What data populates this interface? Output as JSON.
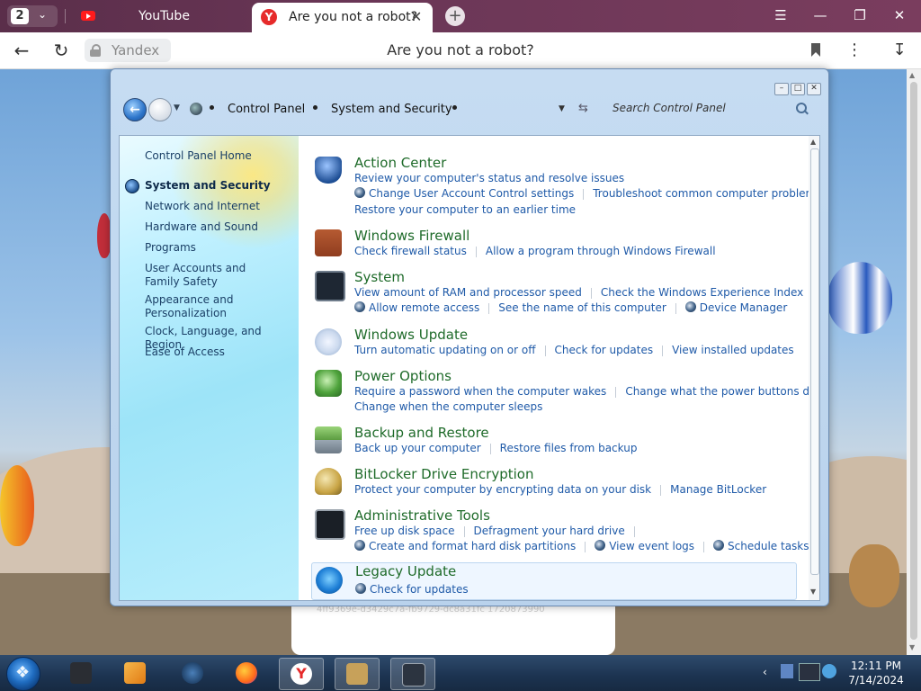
{
  "browser": {
    "tab_count": "2",
    "tabs": [
      {
        "label": "YouTube"
      },
      {
        "label": "Are you not a robot?"
      }
    ],
    "omnibox_site": "Yandex",
    "page_title": "Are you not a robot?"
  },
  "control_panel": {
    "breadcrumb": [
      "Control Panel",
      "System and Security"
    ],
    "search_placeholder": "Search Control Panel",
    "sidebar": [
      {
        "label": "Control Panel Home"
      },
      {
        "label": "System and Security",
        "active": true
      },
      {
        "label": "Network and Internet"
      },
      {
        "label": "Hardware and Sound"
      },
      {
        "label": "Programs"
      },
      {
        "label": "User Accounts and Family Safety"
      },
      {
        "label": "Appearance and Personalization"
      },
      {
        "label": "Clock, Language, and Region"
      },
      {
        "label": "Ease of Access"
      }
    ],
    "categories": [
      {
        "title": "Action Center",
        "rows": [
          [
            "Review your computer's status and resolve issues"
          ],
          [
            "Change User Account Control settings",
            "Troubleshoot common computer problems"
          ],
          [
            "Restore your computer to an earlier time"
          ]
        ]
      },
      {
        "title": "Windows Firewall",
        "rows": [
          [
            "Check firewall status",
            "Allow a program through Windows Firewall"
          ]
        ]
      },
      {
        "title": "System",
        "rows": [
          [
            "View amount of RAM and processor speed",
            "Check the Windows Experience Index"
          ],
          [
            "Allow remote access",
            "See the name of this computer",
            "Device Manager"
          ]
        ]
      },
      {
        "title": "Windows Update",
        "rows": [
          [
            "Turn automatic updating on or off",
            "Check for updates",
            "View installed updates"
          ]
        ]
      },
      {
        "title": "Power Options",
        "rows": [
          [
            "Require a password when the computer wakes",
            "Change what the power buttons do"
          ],
          [
            "Change when the computer sleeps"
          ]
        ]
      },
      {
        "title": "Backup and Restore",
        "rows": [
          [
            "Back up your computer",
            "Restore files from backup"
          ]
        ]
      },
      {
        "title": "BitLocker Drive Encryption",
        "rows": [
          [
            "Protect your computer by encrypting data on your disk",
            "Manage BitLocker"
          ]
        ]
      },
      {
        "title": "Administrative Tools",
        "rows": [
          [
            "Free up disk space",
            "Defragment your hard drive"
          ],
          [
            "Create and format hard disk partitions",
            "View event logs",
            "Schedule tasks"
          ]
        ]
      },
      {
        "title": "Legacy Update",
        "rows": [
          [
            "Check for updates"
          ]
        ]
      }
    ]
  },
  "page_fragment_text": "4ff9369e-d3429c7a-fb9729-dc8a31fc 1720873990",
  "taskbar": {
    "time": "12:11 PM",
    "date": "7/14/2024"
  },
  "colors": {
    "link": "#1f5aa8",
    "category_title": "#1f6b2a",
    "taskbar": "#1c3350"
  }
}
